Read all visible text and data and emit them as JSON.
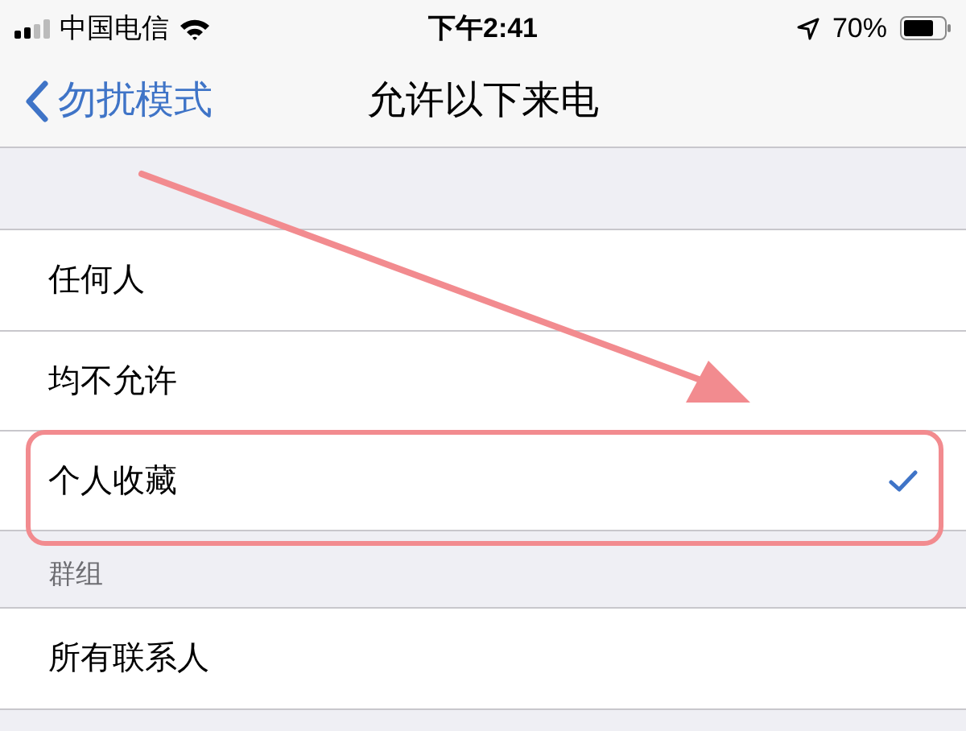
{
  "status_bar": {
    "carrier": "中国电信",
    "time": "下午2:41",
    "battery": "70%"
  },
  "nav": {
    "back": "勿扰模式",
    "title": "允许以下来电"
  },
  "sections": [
    {
      "rows": [
        {
          "label": "任何人",
          "selected": false
        },
        {
          "label": "均不允许",
          "selected": false
        },
        {
          "label": "个人收藏",
          "selected": true
        }
      ]
    },
    {
      "header": "群组",
      "rows": [
        {
          "label": "所有联系人",
          "selected": false
        }
      ]
    }
  ]
}
